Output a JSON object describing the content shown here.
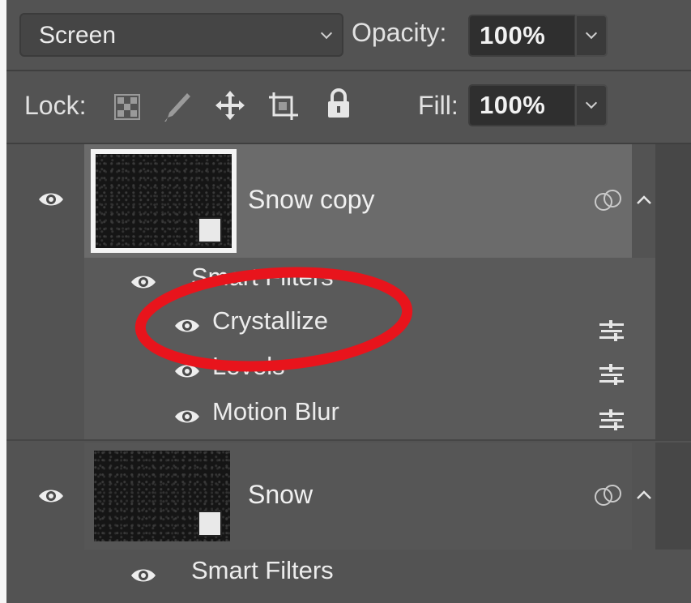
{
  "blend_mode": {
    "value": "Screen"
  },
  "opacity": {
    "label": "Opacity:",
    "value": "100%"
  },
  "lock": {
    "label": "Lock:",
    "icons": [
      "lock-transparent-pixels-icon",
      "lock-image-pixels-icon",
      "lock-position-icon",
      "lock-artboard-icon",
      "lock-all-icon"
    ]
  },
  "fill": {
    "label": "Fill:",
    "value": "100%"
  },
  "layers": [
    {
      "name": "Snow copy",
      "selected": true,
      "filters_label": "Smart Filters",
      "filters": [
        "Crystallize",
        "Levels",
        "Motion Blur"
      ]
    },
    {
      "name": "Snow",
      "selected": false,
      "filters_label": "Smart Filters"
    }
  ],
  "annotation": {
    "color": "#e8141c"
  },
  "colors": {
    "panel": "#535353",
    "selected_layer": "#6b6b6b",
    "filter_section": "#5a5a5a"
  }
}
